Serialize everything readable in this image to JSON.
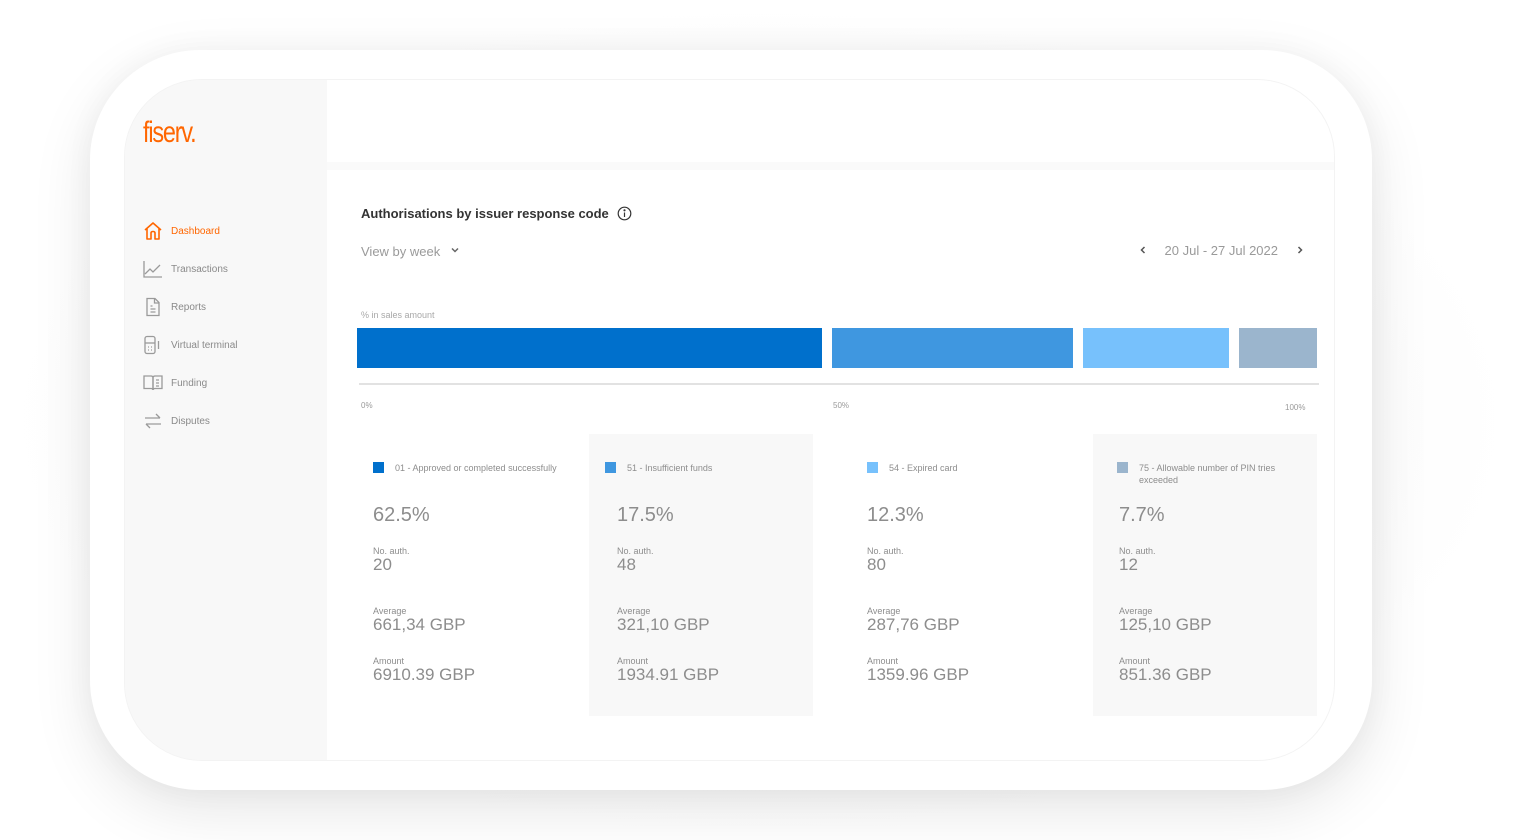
{
  "app": {
    "brand": "fiserv.",
    "brand_color": "#ff6600"
  },
  "sidebar": {
    "items": [
      {
        "label": "Dashboard",
        "icon": "home-icon",
        "active": true
      },
      {
        "label": "Transactions",
        "icon": "line-chart-icon",
        "active": false
      },
      {
        "label": "Reports",
        "icon": "document-icon",
        "active": false
      },
      {
        "label": "Virtual terminal",
        "icon": "card-terminal-icon",
        "active": false
      },
      {
        "label": "Funding",
        "icon": "book-icon",
        "active": false
      },
      {
        "label": "Disputes",
        "icon": "swap-arrows-icon",
        "active": false
      }
    ]
  },
  "widget": {
    "title": "Authorisations by issuer response code",
    "info_icon": "info-icon",
    "view_select": "View by week",
    "date_range": "20 Jul - 27 Jul 2022",
    "axis_label": "% in sales amount",
    "ticks": [
      "0%",
      "50%",
      "100%"
    ]
  },
  "chart_data": {
    "type": "bar",
    "orientation": "horizontal-stacked",
    "xlabel": "% in sales amount",
    "xlim": [
      0,
      100
    ],
    "tick_labels": [
      "0%",
      "50%",
      "100%"
    ],
    "series": [
      {
        "name": "01 - Approved or completed successfully",
        "value": 62.5,
        "color": "#0070cc"
      },
      {
        "name": "51 - Insufficient funds",
        "value": 17.5,
        "color": "#3f97e0"
      },
      {
        "name": "54 - Expired card",
        "value": 12.3,
        "color": "#77c1fc"
      },
      {
        "name": "75 - Allowable number of PIN tries exceeded",
        "value": 7.7,
        "color": "#9bb5cd"
      }
    ]
  },
  "cards": [
    {
      "legend": "01 - Approved or completed successfully",
      "pct": "62.5%",
      "auth_label": "No. auth.",
      "auth": "20",
      "avg_label": "Average",
      "avg": "661,34 GBP",
      "amount_label": "Amount",
      "amount": "6910.39 GBP",
      "color": "#0070cc"
    },
    {
      "legend": "51 - Insufficient funds",
      "pct": "17.5%",
      "auth_label": "No. auth.",
      "auth": "48",
      "avg_label": "Average",
      "avg": "321,10 GBP",
      "amount_label": "Amount",
      "amount": "1934.91 GBP",
      "color": "#3f97e0"
    },
    {
      "legend": "54 - Expired card",
      "pct": "12.3%",
      "auth_label": "No. auth.",
      "auth": "80",
      "avg_label": "Average",
      "avg": "287,76 GBP",
      "amount_label": "Amount",
      "amount": "1359.96 GBP",
      "color": "#77c1fc"
    },
    {
      "legend": "75 - Allowable number of PIN tries exceeded",
      "pct": "7.7%",
      "auth_label": "No. auth.",
      "auth": "12",
      "avg_label": "Average",
      "avg": "125,10 GBP",
      "amount_label": "Amount",
      "amount": "851.36 GBP",
      "color": "#9bb5cd"
    }
  ]
}
